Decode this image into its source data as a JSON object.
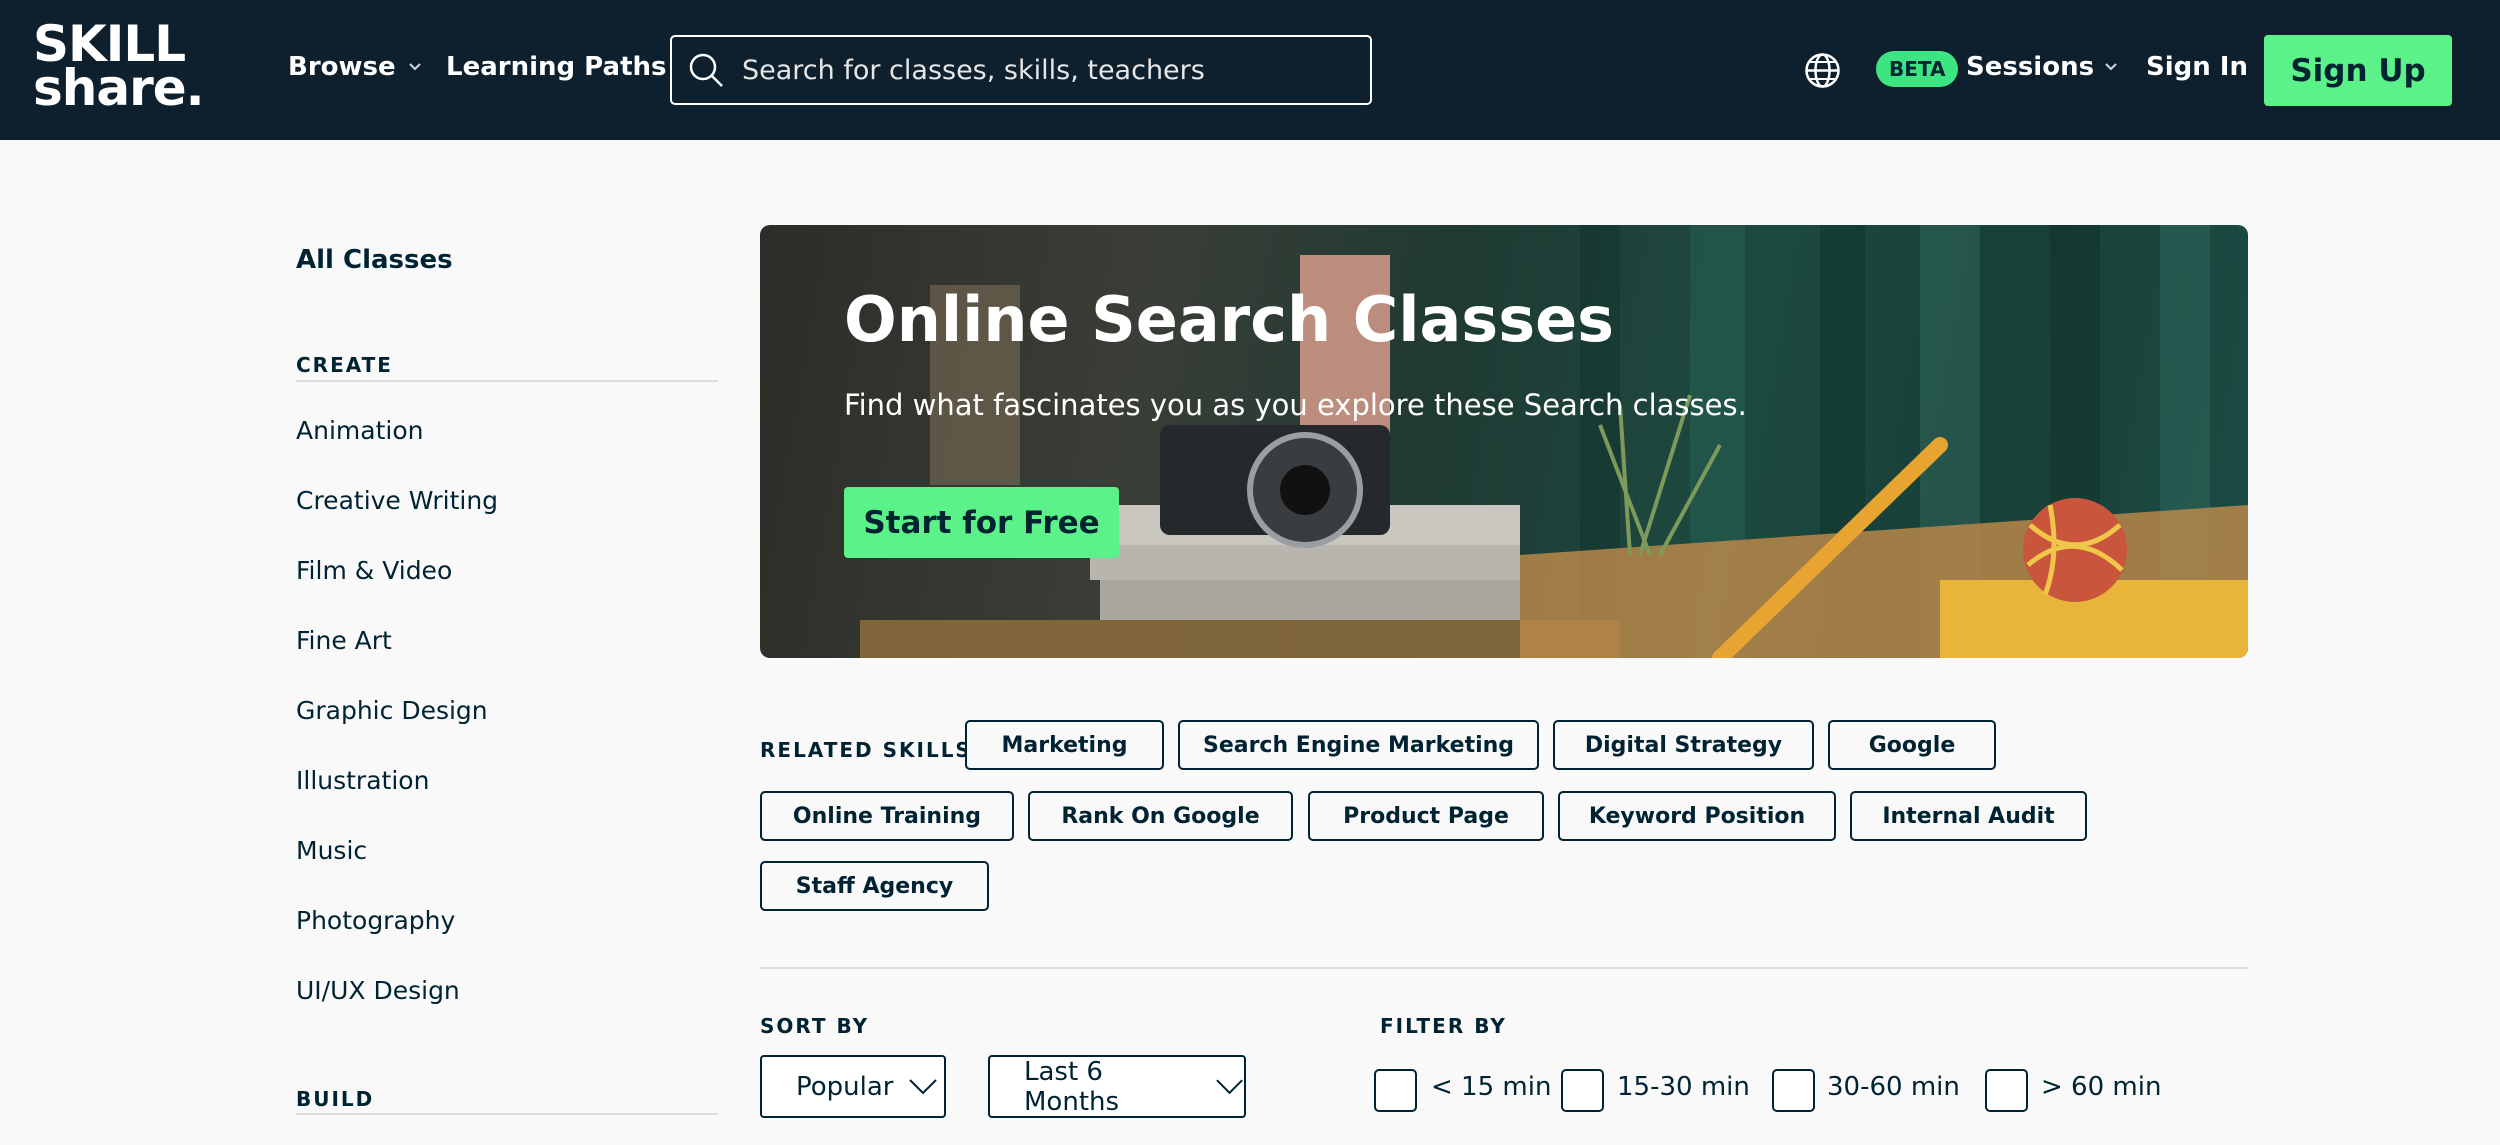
{
  "header": {
    "logo_line1": "SKILL",
    "logo_line2": "share.",
    "browse_label": "Browse",
    "learning_paths_label": "Learning Paths",
    "search_placeholder": "Search for classes, skills, teachers",
    "beta_badge": "BETA",
    "sessions_label": "Sessions",
    "sign_in_label": "Sign In",
    "sign_up_label": "Sign Up",
    "icons": [
      "search-icon",
      "globe-icon",
      "chevron-down-icon"
    ]
  },
  "sidebar": {
    "all_classes": "All Classes",
    "create_heading": "CREATE",
    "create_items": [
      "Animation",
      "Creative Writing",
      "Film & Video",
      "Fine Art",
      "Graphic Design",
      "Illustration",
      "Music",
      "Photography",
      "UI/UX Design"
    ],
    "build_heading": "BUILD"
  },
  "hero": {
    "title": "Online Search Classes",
    "subtitle": "Find what fascinates you as you explore these Search classes.",
    "cta_label": "Start for Free"
  },
  "related_skills": {
    "label": "RELATED SKILLS",
    "chips": [
      "Marketing",
      "Search Engine Marketing",
      "Digital Strategy",
      "Google",
      "Online Training",
      "Rank On Google",
      "Product Page",
      "Keyword Position",
      "Internal Audit",
      "Staff Agency"
    ]
  },
  "sort": {
    "label": "SORT BY",
    "order_value": "Popular",
    "period_value": "Last 6 Months"
  },
  "filter": {
    "label": "FILTER BY",
    "options": [
      "< 15 min",
      "15-30 min",
      "30-60 min",
      "> 60 min"
    ]
  },
  "colors": {
    "header_bg": "#0e202d",
    "accent_green": "#5bf28a",
    "text_dark": "#002333"
  }
}
